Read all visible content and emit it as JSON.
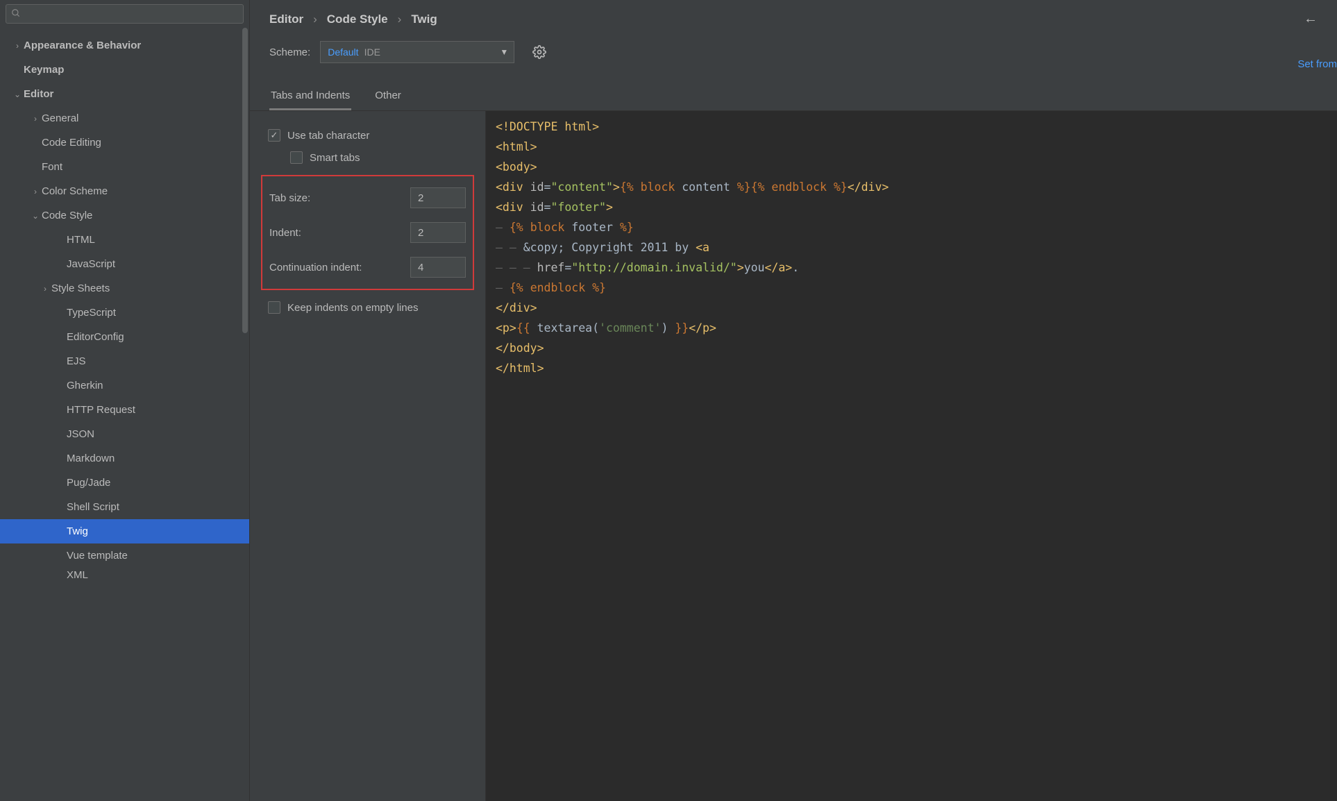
{
  "search": {
    "placeholder": ""
  },
  "sidebar": {
    "items": [
      {
        "label": "Appearance & Behavior",
        "depth": 0,
        "chev": "›",
        "bold": true
      },
      {
        "label": "Keymap",
        "depth": 0,
        "chev": "",
        "bold": true
      },
      {
        "label": "Editor",
        "depth": 0,
        "chev": "⌄",
        "bold": true
      },
      {
        "label": "General",
        "depth": 1,
        "chev": "›"
      },
      {
        "label": "Code Editing",
        "depth": 1,
        "chev": ""
      },
      {
        "label": "Font",
        "depth": 1,
        "chev": ""
      },
      {
        "label": "Color Scheme",
        "depth": 1,
        "chev": "›"
      },
      {
        "label": "Code Style",
        "depth": 1,
        "chev": "⌄"
      },
      {
        "label": "HTML",
        "depth": 3,
        "chev": ""
      },
      {
        "label": "JavaScript",
        "depth": 3,
        "chev": ""
      },
      {
        "label": "Style Sheets",
        "depth": 2,
        "chev": "›"
      },
      {
        "label": "TypeScript",
        "depth": 3,
        "chev": ""
      },
      {
        "label": "EditorConfig",
        "depth": 3,
        "chev": ""
      },
      {
        "label": "EJS",
        "depth": 3,
        "chev": ""
      },
      {
        "label": "Gherkin",
        "depth": 3,
        "chev": ""
      },
      {
        "label": "HTTP Request",
        "depth": 3,
        "chev": ""
      },
      {
        "label": "JSON",
        "depth": 3,
        "chev": ""
      },
      {
        "label": "Markdown",
        "depth": 3,
        "chev": ""
      },
      {
        "label": "Pug/Jade",
        "depth": 3,
        "chev": ""
      },
      {
        "label": "Shell Script",
        "depth": 3,
        "chev": ""
      },
      {
        "label": "Twig",
        "depth": 3,
        "chev": "",
        "selected": true
      },
      {
        "label": "Vue template",
        "depth": 3,
        "chev": ""
      },
      {
        "label": "XML",
        "depth": 3,
        "chev": "",
        "cut": true
      }
    ]
  },
  "breadcrumb": [
    "Editor",
    "Code Style",
    "Twig"
  ],
  "scheme": {
    "label": "Scheme:",
    "value": "Default",
    "scope": "IDE",
    "set_from": "Set from"
  },
  "tabs": {
    "items": [
      "Tabs and Indents",
      "Other"
    ],
    "active": 0
  },
  "form": {
    "use_tab": {
      "label": "Use tab character",
      "checked": true
    },
    "smart": {
      "label": "Smart tabs",
      "checked": false
    },
    "tabsize": {
      "label": "Tab size:",
      "value": "2"
    },
    "indent": {
      "label": "Indent:",
      "value": "2"
    },
    "cont": {
      "label": "Continuation indent:",
      "value": "4"
    },
    "keepempty": {
      "label": "Keep indents on empty lines",
      "checked": false
    }
  },
  "code": {
    "l1": "<!DOCTYPE html>",
    "l2": "<html>",
    "l3": "<body>",
    "l4a": "<div ",
    "l4_attr": "id",
    "l4_val": "\"content\"",
    "l4_gt": ">",
    "l4_twopen": "{% ",
    "l4_block": "block",
    "l4_name": " content ",
    "l4_twclose": "%}",
    "l4_twopen2": "{% ",
    "l4_endblock": "endblock",
    "l4_twclose2": " %}",
    "l4_divclose": "</div>",
    "l5a": "<div ",
    "l5_attr": "id",
    "l5_val": "\"footer\"",
    "l5_gt": ">",
    "l6_guide": "— ",
    "l6_twopen": "{% ",
    "l6_block": "block",
    "l6_name": " footer ",
    "l6_twclose": "%}",
    "l7_guide": "— — ",
    "l7_text": "&copy; Copyright 2011 by ",
    "l7_a": "<a",
    "l8_guide": "— — — ",
    "l8_attr": "href",
    "l8_val": "\"http://domain.invalid/\"",
    "l8_gt": ">",
    "l8_you": "you",
    "l8_aclose": "</a>",
    "l8_dot": ".",
    "l9_guide": "— ",
    "l9_twopen": "{% ",
    "l9_endblock": "endblock",
    "l9_twclose": " %}",
    "l10": "</div>",
    "l11_p": "<p>",
    "l11_dopen": "{{ ",
    "l11_fn": "textarea(",
    "l11_str": "'comment'",
    "l11_fnend": ") ",
    "l11_dclose": "}}",
    "l11_pclose": "</p>",
    "l12": "</body>",
    "l13": "</html>"
  }
}
